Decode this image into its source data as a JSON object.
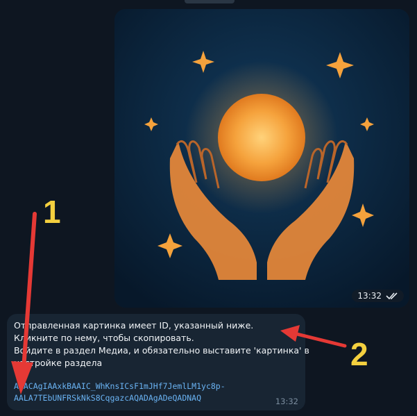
{
  "image_message": {
    "time": "13:32",
    "status_icon": "double-check-icon"
  },
  "text_message": {
    "lines": [
      "Отправленная картинка имеет ID, указанный ниже.",
      "Кликните по нему, чтобы скопировать.",
      "Войдите в раздел Медиа, и обязательно выставите 'картинка' в",
      "настройке раздела"
    ],
    "image_id_line1": "AgACAgIAAxkBAAIC_WhKnsICsF1mJHf7JemlLM1yc8p-",
    "image_id_line2": "AALA7TEbUNFRSkNkS8CqgazcAQADAgADeQADNAQ",
    "time": "13:32"
  },
  "annotations": {
    "label_1": "1",
    "label_2": "2",
    "color": "#f4d03f",
    "arrow_color": "#e53935"
  },
  "colors": {
    "background": "#0e1621",
    "bubble": "#182533",
    "link": "#6ab3f3"
  }
}
